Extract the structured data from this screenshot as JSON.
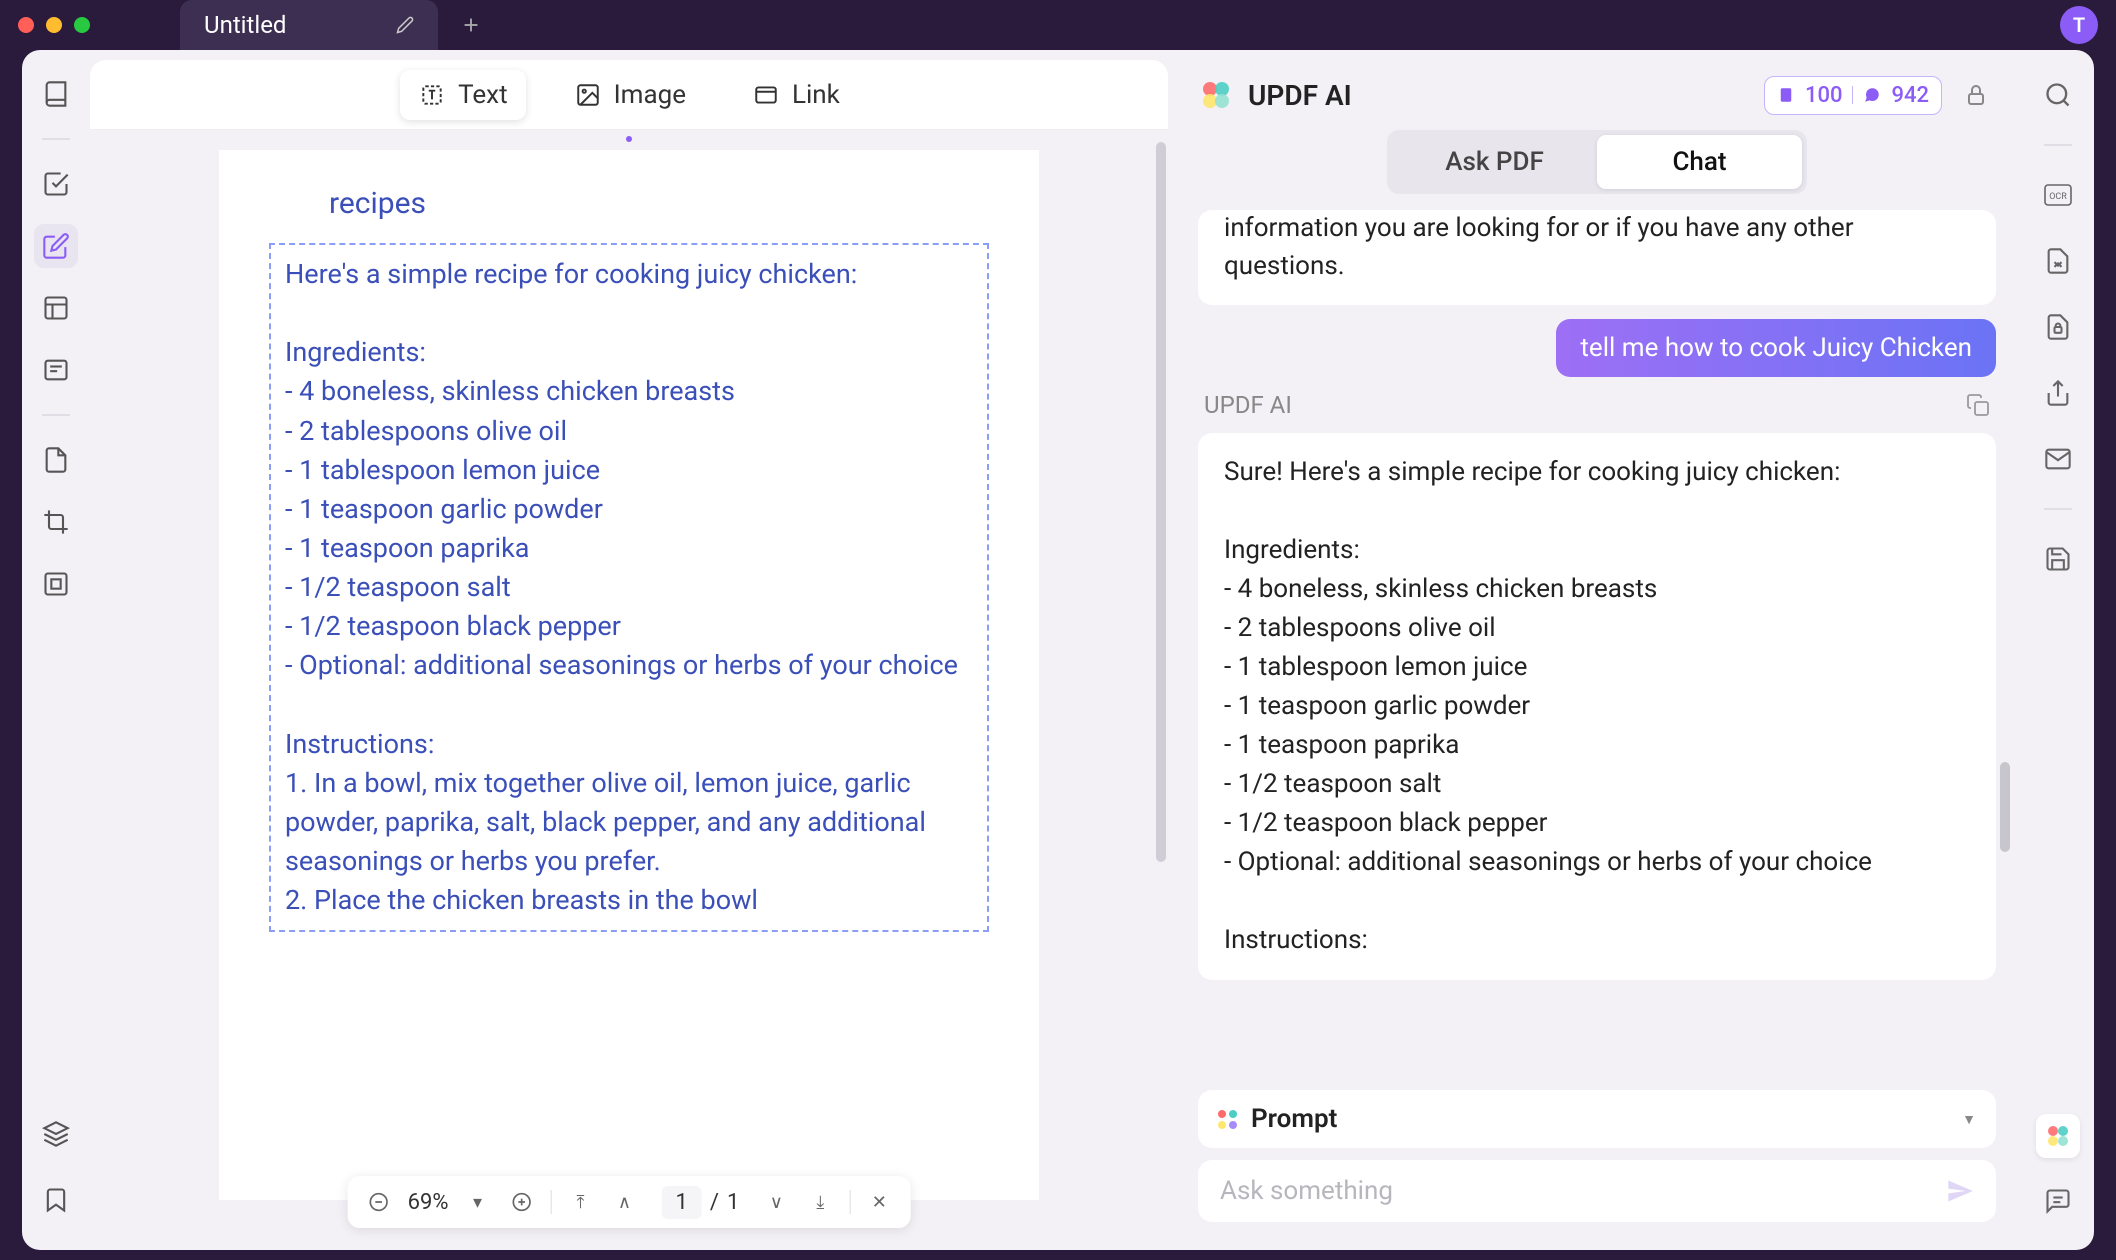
{
  "titlebar": {
    "tab_name": "Untitled",
    "user_initial": "T"
  },
  "toolbar": {
    "text_label": "Text",
    "image_label": "Image",
    "link_label": "Link"
  },
  "document": {
    "title": "recipes",
    "body": "Here's a simple recipe for cooking juicy chicken:\n\nIngredients:\n- 4 boneless, skinless chicken breasts\n- 2 tablespoons olive oil\n- 1 tablespoon lemon juice\n- 1 teaspoon garlic powder\n- 1 teaspoon paprika\n- 1/2 teaspoon salt\n- 1/2 teaspoon black pepper\n- Optional: additional seasonings or herbs of your choice\n\nInstructions:\n1. In a bowl, mix together olive oil, lemon juice, garlic powder, paprika, salt, black pepper, and any additional seasonings or herbs you prefer.\n2. Place the chicken breasts in the bowl"
  },
  "page_controls": {
    "zoom": "69%",
    "current_page": "1",
    "page_sep": "/",
    "total_pages": "1"
  },
  "ai": {
    "title": "UPDF AI",
    "credits_1": "100",
    "credits_2": "942",
    "mode_ask": "Ask PDF",
    "mode_chat": "Chat",
    "prev_assistant_snippet": "information you are looking for or if you have any other questions.",
    "user_msg": "tell me how to cook Juicy Chicken",
    "assistant_label": "UPDF AI",
    "assistant_msg": "Sure! Here's a simple recipe for cooking juicy chicken:\n\nIngredients:\n- 4 boneless, skinless chicken breasts\n- 2 tablespoons olive oil\n- 1 tablespoon lemon juice\n- 1 teaspoon garlic powder\n- 1 teaspoon paprika\n- 1/2 teaspoon salt\n- 1/2 teaspoon black pepper\n- Optional: additional seasonings or herbs of your choice\n\nInstructions:",
    "prompt_label": "Prompt",
    "input_placeholder": "Ask something"
  }
}
